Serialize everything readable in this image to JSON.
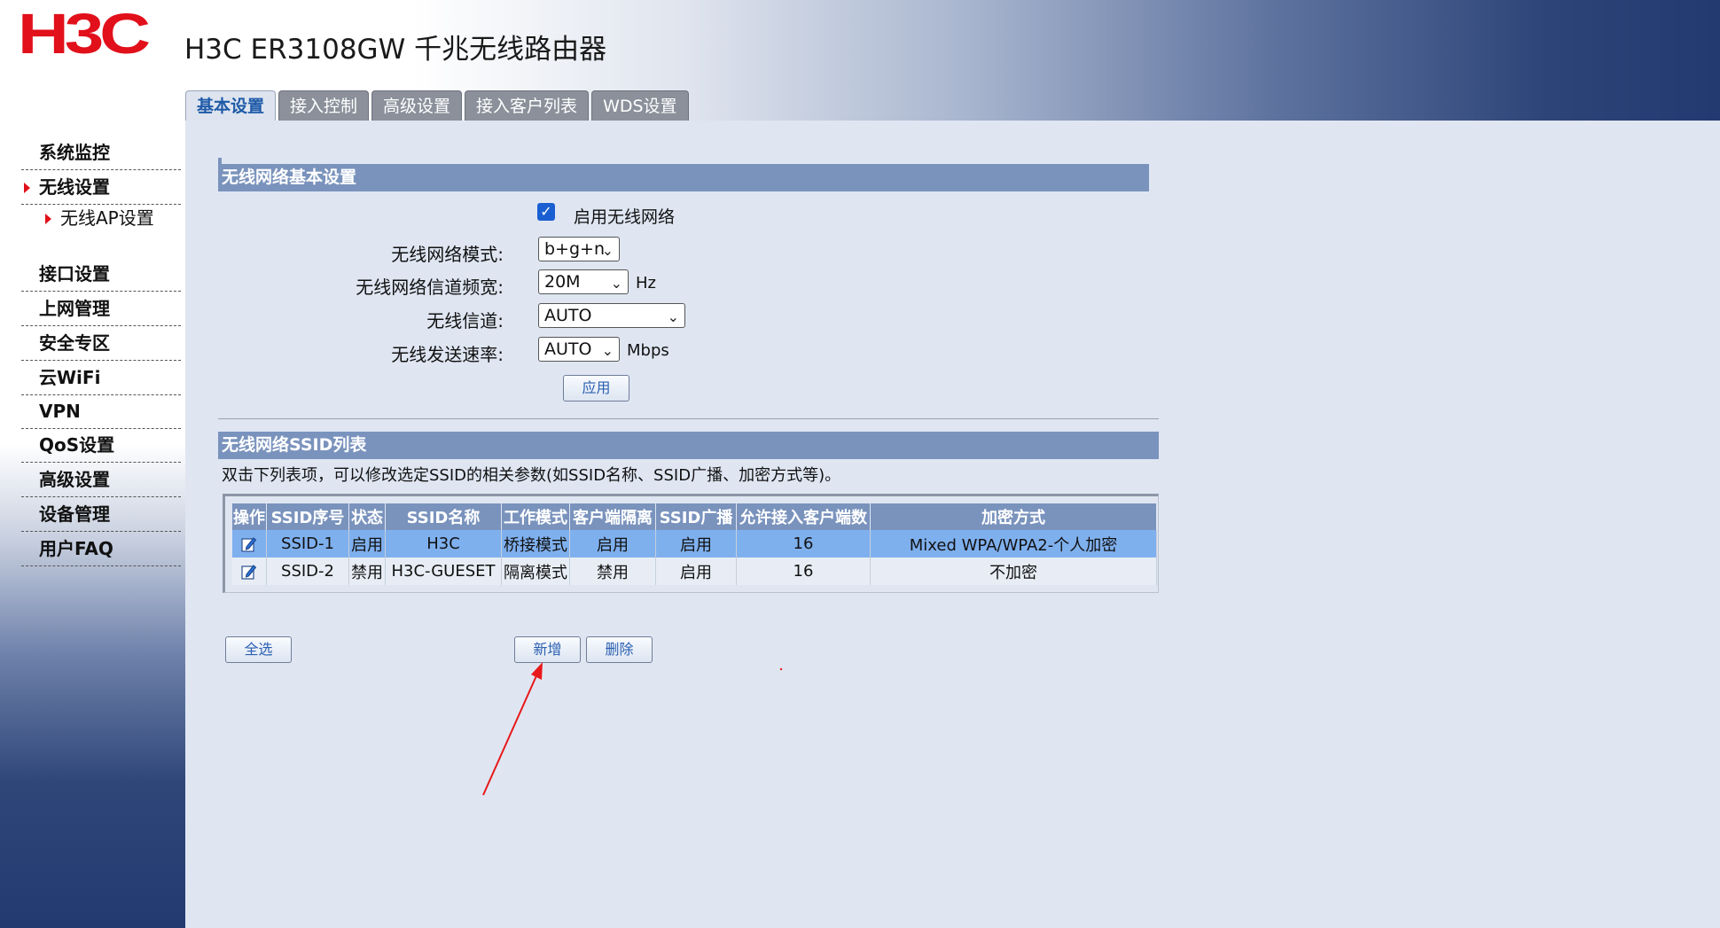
{
  "header": {
    "logo_text": "H3C",
    "product_title": "H3C ER3108GW 千兆无线路由器"
  },
  "tabs": [
    {
      "label": "基本设置",
      "active": true
    },
    {
      "label": "接入控制",
      "active": false
    },
    {
      "label": "高级设置",
      "active": false
    },
    {
      "label": "接入客户列表",
      "active": false
    },
    {
      "label": "WDS设置",
      "active": false
    }
  ],
  "sidebar": {
    "items": [
      {
        "label": "系统监控"
      },
      {
        "label": "无线设置",
        "selected": true
      },
      {
        "label": "接口设置"
      },
      {
        "label": "上网管理"
      },
      {
        "label": "安全专区"
      },
      {
        "label": "云WiFi"
      },
      {
        "label": "VPN"
      },
      {
        "label": "QoS设置"
      },
      {
        "label": "高级设置"
      },
      {
        "label": "设备管理"
      },
      {
        "label": "用户FAQ"
      }
    ],
    "sub_item": {
      "label": "无线AP设置"
    }
  },
  "basic": {
    "section_title": "无线网络基本设置",
    "enable_label": "启用无线网络",
    "enable_checked": true,
    "mode_label": "无线网络模式:",
    "mode_value": "b+g+n",
    "bandwidth_label": "无线网络信道频宽:",
    "bandwidth_value": "20M",
    "bandwidth_unit": "Hz",
    "channel_label": "无线信道:",
    "channel_value": "AUTO",
    "rate_label": "无线发送速率:",
    "rate_value": "AUTO",
    "rate_unit": "Mbps",
    "apply_label": "应用"
  },
  "ssid": {
    "section_title": "无线网络SSID列表",
    "hint": "双击下列表项，可以修改选定SSID的相关参数(如SSID名称、SSID广播、加密方式等)。",
    "columns": [
      "操作",
      "SSID序号",
      "状态",
      "SSID名称",
      "工作模式",
      "客户端隔离",
      "SSID广播",
      "允许接入客户端数",
      "加密方式"
    ],
    "rows": [
      {
        "index": "SSID-1",
        "status": "启用",
        "name": "H3C",
        "mode": "桥接模式",
        "isolation": "启用",
        "broadcast": "启用",
        "max_clients": "16",
        "encryption": "Mixed WPA/WPA2-个人加密",
        "selected": true
      },
      {
        "index": "SSID-2",
        "status": "禁用",
        "name": "H3C-GUESET",
        "mode": "隔离模式",
        "isolation": "禁用",
        "broadcast": "启用",
        "max_clients": "16",
        "encryption": "不加密",
        "selected": false
      }
    ],
    "select_all_label": "全选",
    "add_label": "新增",
    "delete_label": "删除"
  },
  "colors": {
    "brand_red": "#e1101a",
    "section_bar": "#7a93bd",
    "selected_row": "#7fb0ee",
    "content_bg": "#dfe6f2",
    "annotation_arrow": "#e8191a"
  }
}
